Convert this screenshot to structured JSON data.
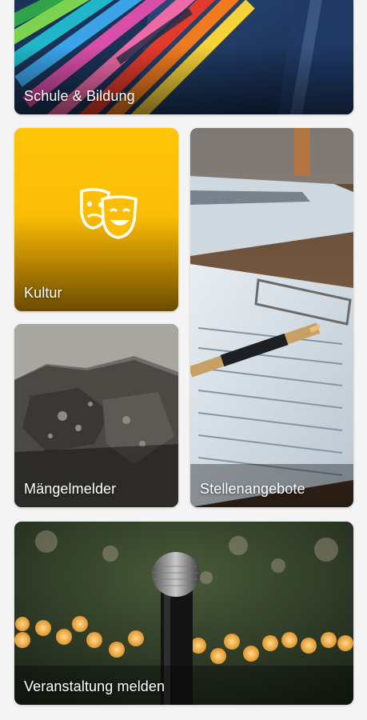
{
  "tiles": {
    "schule": {
      "label": "Schule & Bildung",
      "icon": "pencils-photo"
    },
    "kultur": {
      "label": "Kultur",
      "icon": "theater-masks-icon",
      "color": "#fbbd06"
    },
    "maengel": {
      "label": "Mängelmelder",
      "icon": "cracked-asphalt-photo"
    },
    "stellen": {
      "label": "Stellenangebote",
      "icon": "document-pen-photo"
    },
    "veranstaltung": {
      "label": "Veranstaltung melden",
      "icon": "microphone-photo"
    }
  }
}
